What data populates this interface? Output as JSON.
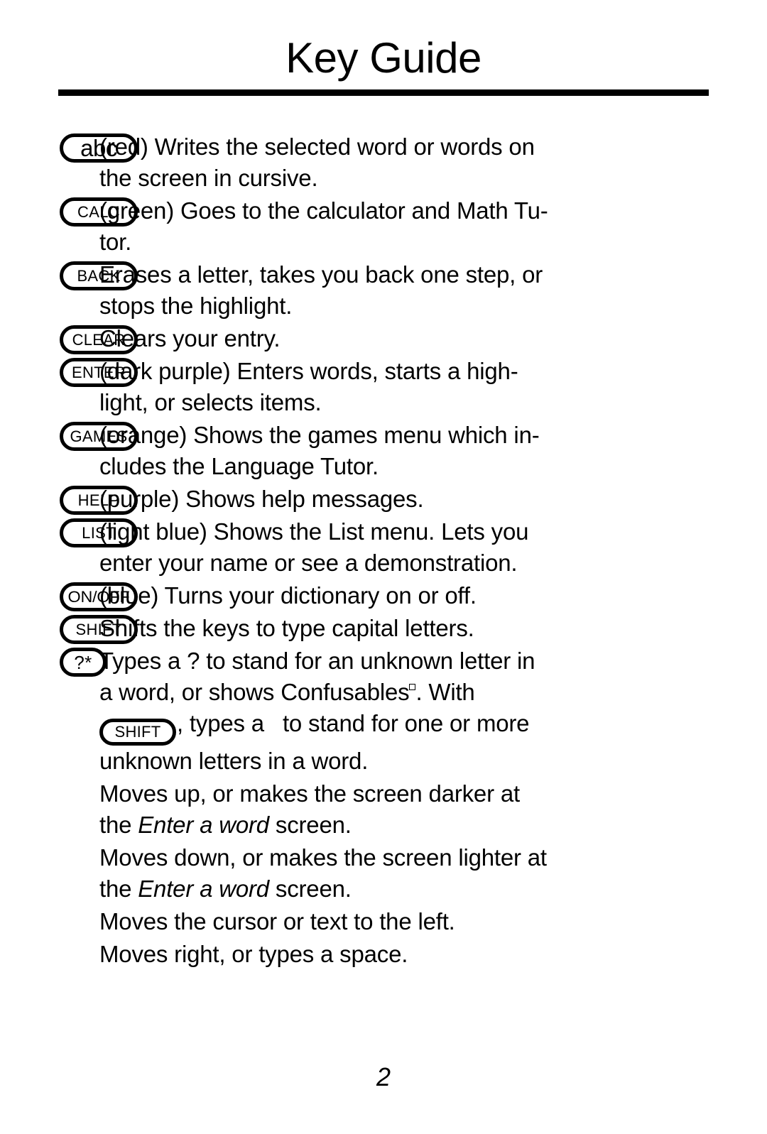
{
  "document": {
    "title": "Key Guide",
    "page_number": "2"
  },
  "entries": [
    {
      "key_label": "abc",
      "description_line1": "(red) Writes the selected word or words on",
      "description_line2": "the screen in cursive."
    },
    {
      "key_label": "CALC",
      "description_line1": "(green) Goes to the calculator and Math Tu-",
      "description_line2": "tor."
    },
    {
      "key_label": "BACK",
      "description_line1": "Erases a letter, takes you back one step, or",
      "description_line2": "stops the highlight."
    },
    {
      "key_label": "CLEAR",
      "description_line1": "Clears your entry.",
      "description_line2": ""
    },
    {
      "key_label": "ENTER",
      "description_line1": "(dark purple) Enters words, starts a high-",
      "description_line2": "light, or selects items."
    },
    {
      "key_label": "GAMES",
      "description_line1": "(orange) Shows the games menu which in-",
      "description_line2": "cludes the Language Tutor."
    },
    {
      "key_label": "HELP",
      "description_line1": "(purple) Shows help messages.",
      "description_line2": ""
    },
    {
      "key_label": "LIST",
      "description_line1": "(light blue) Shows the List menu. Lets you",
      "description_line2": "enter your name or see a demonstration."
    },
    {
      "key_label": "ON/OFF",
      "description_line1": "(blue) Turns your dictionary on or off.",
      "description_line2": ""
    },
    {
      "key_label": "SHIFT",
      "description_line1": "Shifts the keys to type capital letters.",
      "description_line2": ""
    }
  ],
  "question_key_entry": {
    "key_label": "?*",
    "line1": "Types a ? to stand for an unknown letter in",
    "line2_before_mark": "a word, or shows Confusables",
    "line2_after_mark": ". With",
    "inline_key_label": "SHIFT",
    "line3_after_key": ", types a",
    "line3_tail": "to stand for one or more",
    "line4": "unknown letters in a word."
  },
  "arrow_entries": [
    {
      "line1_prefix": "Moves up, or makes the screen darker at",
      "line2_prefix": "the ",
      "line2_italic": "Enter a word",
      "line2_suffix": " screen."
    },
    {
      "line1_prefix": "Moves down, or makes the screen lighter at",
      "line2_prefix": "the ",
      "line2_italic": "Enter a word",
      "line2_suffix": " screen."
    },
    {
      "line1_prefix": "Moves the cursor or text to the left.",
      "line2_prefix": "",
      "line2_italic": "",
      "line2_suffix": ""
    },
    {
      "line1_prefix": "Moves right, or types a space.",
      "line2_prefix": "",
      "line2_italic": "",
      "line2_suffix": ""
    }
  ]
}
